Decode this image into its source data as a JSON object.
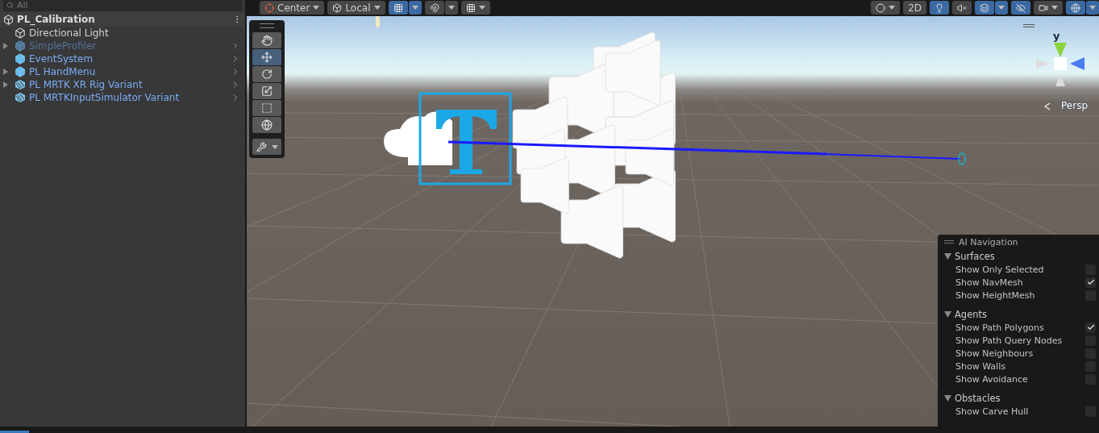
{
  "hierarchy": {
    "search": {
      "placeholder": "All"
    },
    "scene": {
      "name": "PL_Calibration"
    },
    "items": [
      {
        "kind": "light",
        "label": "Directional Light",
        "disabled": false,
        "expandable": false,
        "has_chevron": false
      },
      {
        "kind": "prefab",
        "label": "SimpleProfiler",
        "disabled": true,
        "expandable": true,
        "has_chevron": true
      },
      {
        "kind": "prefab",
        "label": "EventSystem",
        "disabled": false,
        "expandable": false,
        "has_chevron": true
      },
      {
        "kind": "prefab",
        "label": "PL HandMenu",
        "disabled": false,
        "expandable": true,
        "has_chevron": true
      },
      {
        "kind": "variant",
        "label": "PL MRTK XR Rig Variant",
        "disabled": false,
        "expandable": true,
        "has_chevron": true
      },
      {
        "kind": "variant",
        "label": "PL MRTKInputSimulator Variant",
        "disabled": false,
        "expandable": false,
        "has_chevron": true
      }
    ]
  },
  "scene_toolbar": {
    "left": [
      {
        "kind": "pivot",
        "label": "Center",
        "selected": false
      },
      {
        "kind": "space",
        "label": "Local",
        "selected": false
      },
      {
        "kind": "grid-snap",
        "selected": true
      },
      {
        "kind": "increment-snap",
        "selected": false
      },
      {
        "kind": "grid",
        "selected": false
      }
    ],
    "right": [
      {
        "kind": "shading",
        "selected": false
      },
      {
        "kind": "mode",
        "label": "2D",
        "selected": false
      },
      {
        "kind": "lighting",
        "selected": true
      },
      {
        "kind": "audio",
        "selected": false
      },
      {
        "kind": "effects",
        "selected": true
      },
      {
        "kind": "visibility",
        "selected": true
      },
      {
        "kind": "camera",
        "selected": false
      },
      {
        "kind": "gizmos",
        "selected": true
      }
    ]
  },
  "tools": [
    {
      "kind": "hand",
      "selected": false
    },
    {
      "kind": "move",
      "selected": true
    },
    {
      "kind": "rotate",
      "selected": false
    },
    {
      "kind": "scale",
      "selected": false
    },
    {
      "kind": "rect",
      "selected": false
    },
    {
      "kind": "transform",
      "selected": false
    }
  ],
  "orientation_gizmo": {
    "y_label": "y",
    "projection": "Persp"
  },
  "ai_navigation": {
    "title": "AI Navigation",
    "sections": [
      {
        "title": "Surfaces",
        "expanded": true,
        "options": [
          {
            "label": "Show Only Selected",
            "checked": false
          },
          {
            "label": "Show NavMesh",
            "checked": true
          },
          {
            "label": "Show HeightMesh",
            "checked": false
          }
        ]
      },
      {
        "title": "Agents",
        "expanded": true,
        "options": [
          {
            "label": "Show Path Polygons",
            "checked": true
          },
          {
            "label": "Show Path Query Nodes",
            "checked": false
          },
          {
            "label": "Show Neighbours",
            "checked": false
          },
          {
            "label": "Show Walls",
            "checked": false
          },
          {
            "label": "Show Avoidance",
            "checked": false
          }
        ]
      },
      {
        "title": "Obstacles",
        "expanded": true,
        "options": [
          {
            "label": "Show Carve Hull",
            "checked": false
          }
        ]
      }
    ]
  }
}
